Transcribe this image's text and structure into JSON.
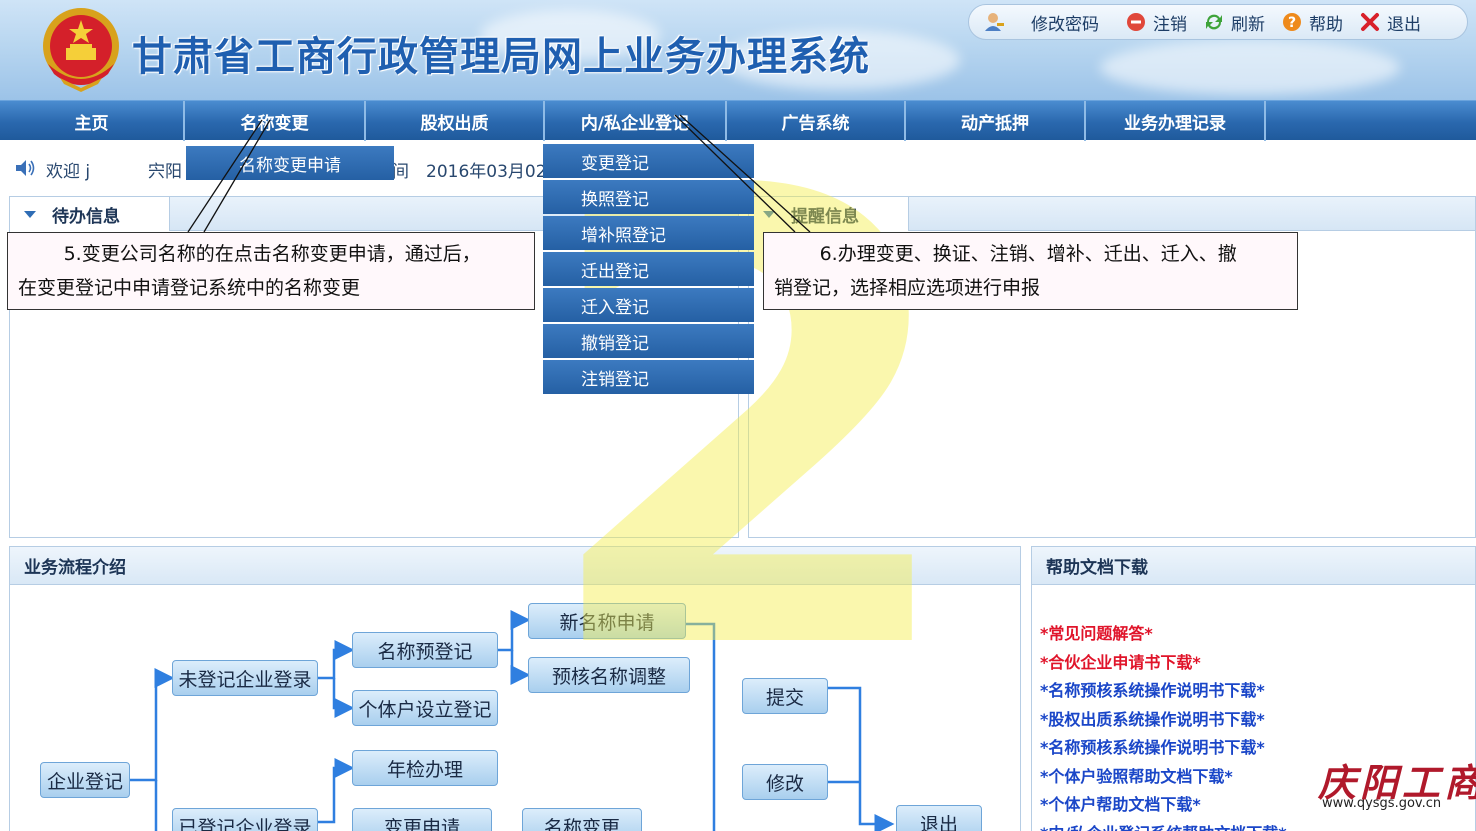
{
  "header": {
    "title": "甘肃省工商行政管理局网上业务办理系统",
    "toolbar": [
      {
        "label": "修改密码",
        "icon": "user-key-icon"
      },
      {
        "label": "注销",
        "icon": "logout-icon"
      },
      {
        "label": "刷新",
        "icon": "refresh-icon"
      },
      {
        "label": "帮助",
        "icon": "help-icon"
      },
      {
        "label": "退出",
        "icon": "close-icon"
      }
    ]
  },
  "nav": {
    "items": [
      "主页",
      "名称变更",
      "股权出质",
      "内/私企业登记",
      "广告系统",
      "动产抵押",
      "业务办理记录"
    ],
    "name_change_submenu": [
      "名称变更申请"
    ],
    "enterprise_dropdown": [
      "变更登记",
      "换照登记",
      "增补照登记",
      "迁出登记",
      "迁入登记",
      "撤销登记",
      "注销登记"
    ]
  },
  "welcome": {
    "greeting": "欢迎 j",
    "name_fragment": "宍阳",
    "separator": "间",
    "date": "2016年03月02"
  },
  "panels": {
    "todo_tab": "待办信息",
    "reminder_tab": "提醒信息",
    "flow_title": "业务流程介绍",
    "help_title": "帮助文档下载"
  },
  "callouts": {
    "left_line1": "5.变更公司名称的在点击名称变更申请，通过后，",
    "left_line2": "在变更登记中申请登记系统中的名称变更",
    "right_line1": "6.办理变更、换证、注销、增补、迁出、迁入、撤",
    "right_line2": "销登记，选择相应选项进行申报"
  },
  "flow": {
    "enterprise": "企业登记",
    "unregistered": "未登记企业登录",
    "registered": "已登记企业登录",
    "name_prereg": "名称预登记",
    "individual": "个体户设立登记",
    "new_name": "新名称申请",
    "prereview_adjust": "预核名称调整",
    "annual_check": "年检办理",
    "change_apply": "变更申请",
    "name_change": "名称变更",
    "submit": "提交",
    "modify": "修改",
    "exit": "退出"
  },
  "help_links": [
    {
      "text": "*常见问题解答*",
      "color": "#e0142a"
    },
    {
      "text": "*合伙企业申请书下载*",
      "color": "#e0142a"
    },
    {
      "text": "*名称预核系统操作说明书下载*",
      "color": "#1a46c8"
    },
    {
      "text": "*股权出质系统操作说明书下载*",
      "color": "#1a46c8"
    },
    {
      "text": "*名称预核系统操作说明书下载*",
      "color": "#1a46c8"
    },
    {
      "text": "*个体户验照帮助文档下载*",
      "color": "#1a46c8"
    },
    {
      "text": "*个体户帮助文档下载*",
      "color": "#1a46c8"
    },
    {
      "text": "*内/私企业登记系统帮助文档下载*",
      "color": "#1a46c8"
    }
  ],
  "watermark": "2",
  "brand": {
    "logo": "庆阳工商",
    "url": "www.qysgs.gov.cn"
  }
}
